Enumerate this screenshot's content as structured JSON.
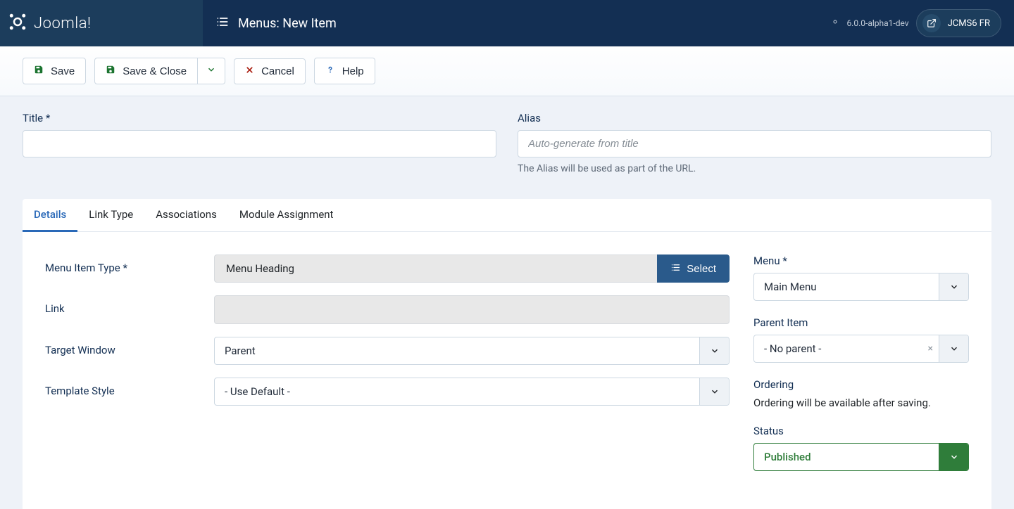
{
  "header": {
    "brand": "Joomla!",
    "page_title": "Menus: New Item",
    "version": "6.0.0-alpha1-dev",
    "site_button": "JCMS6 FR"
  },
  "toolbar": {
    "save": "Save",
    "save_close": "Save & Close",
    "cancel": "Cancel",
    "help": "Help"
  },
  "form": {
    "title_label": "Title *",
    "title_value": "",
    "alias_label": "Alias",
    "alias_placeholder": "Auto-generate from title",
    "alias_help": "The Alias will be used as part of the URL."
  },
  "tabs": [
    "Details",
    "Link Type",
    "Associations",
    "Module Assignment"
  ],
  "active_tab": 0,
  "details": {
    "menu_item_type_label": "Menu Item Type *",
    "menu_item_type_value": "Menu Heading",
    "select_btn": "Select",
    "link_label": "Link",
    "link_value": "",
    "target_window_label": "Target Window",
    "target_window_value": "Parent",
    "template_style_label": "Template Style",
    "template_style_value": "- Use Default -"
  },
  "side": {
    "menu_label": "Menu *",
    "menu_value": "Main Menu",
    "parent_label": "Parent Item",
    "parent_value": "- No parent -",
    "ordering_label": "Ordering",
    "ordering_text": "Ordering will be available after saving.",
    "status_label": "Status",
    "status_value": "Published"
  }
}
